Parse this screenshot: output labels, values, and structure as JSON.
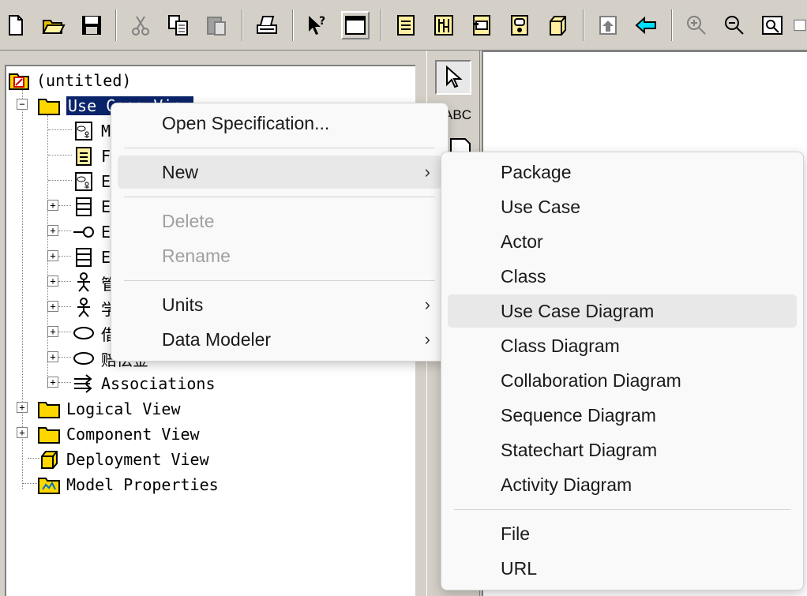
{
  "toolbar": {
    "buttons": [
      {
        "name": "new-icon"
      },
      {
        "name": "open-icon"
      },
      {
        "name": "save-icon"
      },
      {
        "name": "cut-icon"
      },
      {
        "name": "copy-icon"
      },
      {
        "name": "paste-icon"
      },
      {
        "name": "print-icon"
      },
      {
        "name": "context-help-icon"
      },
      {
        "name": "view-doc-window-icon"
      },
      {
        "name": "browse-class-diagram-icon"
      },
      {
        "name": "browse-interaction-diagram-icon"
      },
      {
        "name": "browse-component-diagram-icon"
      },
      {
        "name": "browse-state-diagram-icon"
      },
      {
        "name": "browse-deployment-diagram-icon"
      },
      {
        "name": "browse-parent-icon"
      },
      {
        "name": "browse-previous-icon"
      },
      {
        "name": "zoom-in-icon"
      },
      {
        "name": "zoom-out-icon"
      },
      {
        "name": "fit-in-window-icon"
      }
    ]
  },
  "tree": {
    "root": "(untitled)",
    "use_case_view": "Use Case View",
    "children": [
      {
        "icon": "use-case-diagram-icon",
        "label": "M"
      },
      {
        "icon": "class-diagram-icon",
        "label": "F"
      },
      {
        "icon": "use-case-diagram-icon",
        "label": "E"
      },
      {
        "icon": "class-icon",
        "label": "E"
      },
      {
        "icon": "interface-icon",
        "label": "E"
      },
      {
        "icon": "class-icon",
        "label": "E"
      },
      {
        "icon": "actor-icon",
        "label": "管"
      },
      {
        "icon": "actor-icon",
        "label": "学"
      },
      {
        "icon": "use-case-icon",
        "label": "借"
      },
      {
        "icon": "use-case-icon",
        "label": "赔偿金"
      },
      {
        "icon": "associations-icon",
        "label": "Associations"
      }
    ],
    "top_level": [
      {
        "label": "Logical View"
      },
      {
        "label": "Component View"
      },
      {
        "label": "Deployment View"
      },
      {
        "label": "Model Properties"
      }
    ]
  },
  "toolbox": {
    "items": [
      {
        "name": "selection-tool-icon"
      },
      {
        "name": "text-box-tool-icon",
        "label": "ABC"
      },
      {
        "name": "note-tool-icon"
      }
    ]
  },
  "context_menu": {
    "items": [
      {
        "label": "Open Specification...",
        "enabled": true
      },
      {
        "label": "New",
        "enabled": true,
        "submenu": true
      },
      {
        "label": "Delete",
        "enabled": false
      },
      {
        "label": "Rename",
        "enabled": false
      },
      {
        "label": "Units",
        "enabled": true,
        "submenu": true
      },
      {
        "label": "Data Modeler",
        "enabled": true,
        "submenu": true
      }
    ]
  },
  "submenu_new": {
    "items": [
      {
        "label": "Package"
      },
      {
        "label": "Use Case"
      },
      {
        "label": "Actor"
      },
      {
        "label": "Class"
      },
      {
        "label": "Use Case Diagram"
      },
      {
        "label": "Class Diagram"
      },
      {
        "label": "Collaboration Diagram"
      },
      {
        "label": "Sequence Diagram"
      },
      {
        "label": "Statechart Diagram"
      },
      {
        "label": "Activity Diagram"
      },
      {
        "label": "File"
      },
      {
        "label": "URL"
      }
    ]
  },
  "colors": {
    "selection": "#0a246a",
    "folder": "#ffd700",
    "menu_bg": "#f9f9f9",
    "menu_hover": "#e8e8e8",
    "disabled_text": "#a0a0a0"
  }
}
